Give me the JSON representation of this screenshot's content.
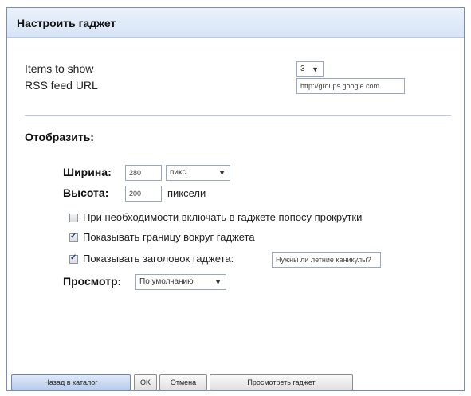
{
  "dialog": {
    "title": "Настроить гаджет"
  },
  "settings": {
    "items_to_show_label": "Items to show",
    "items_to_show_value": "3",
    "rss_label": "RSS feed URL",
    "rss_value": "http://groups.google.com"
  },
  "display": {
    "section_title": "Отобразить:",
    "width_label": "Ширина:",
    "width_value": "280",
    "width_unit": "пикс.",
    "height_label": "Высота:",
    "height_value": "200",
    "height_unit": "пиксели",
    "scroll_label": "При необходимости включать в гаджете попосу прокрутки",
    "scroll_checked": false,
    "border_label": "Показывать границу вокруг гаджета",
    "border_checked": true,
    "header_label": "Показывать заголовок гаджета:",
    "header_checked": true,
    "header_value": "Нужны ли летние каникулы?",
    "preview_label": "Просмотр:",
    "preview_value": "По умолчанию"
  },
  "buttons": {
    "back": "Назад в каталог",
    "ok": "OK",
    "cancel": "Отмена",
    "preview": "Просмотреть гаджет"
  }
}
